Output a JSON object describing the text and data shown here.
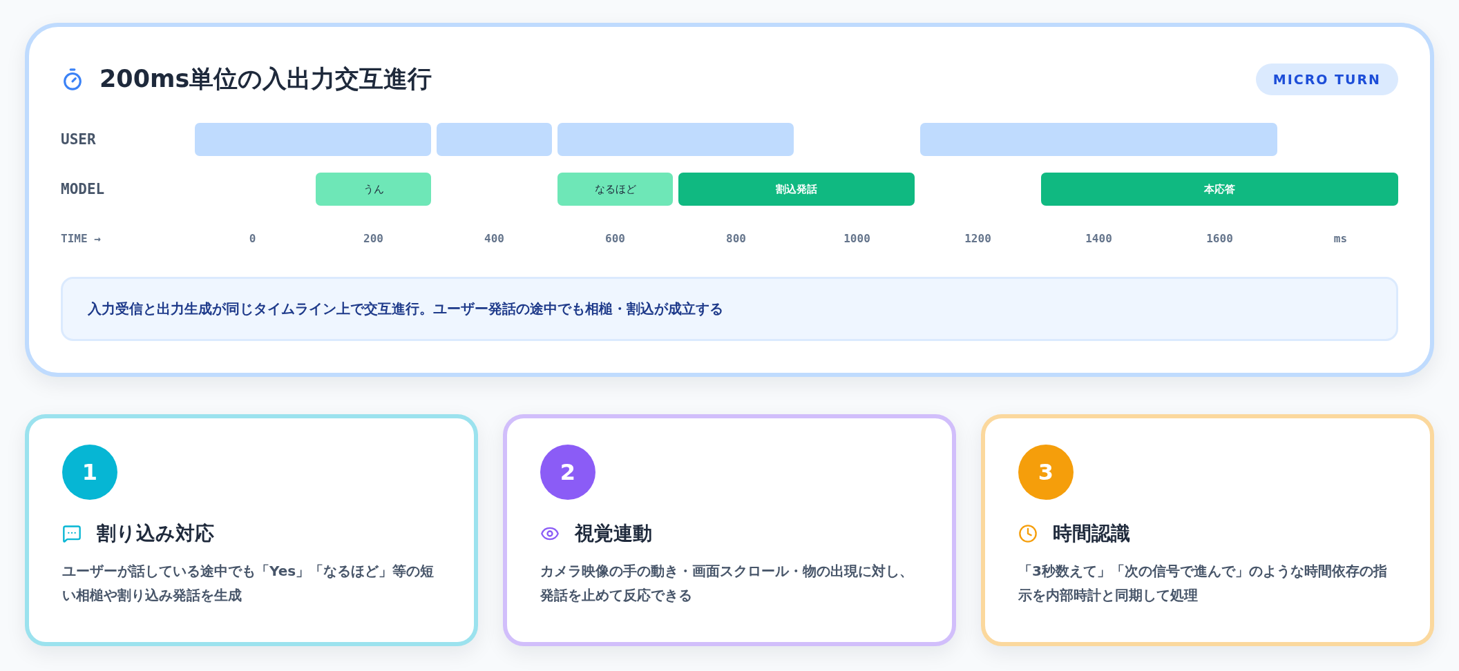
{
  "timeline_card": {
    "title": "200ms単位の入出力交互進行",
    "badge": "MICRO TURN",
    "tracks": [
      {
        "label": "USER",
        "segments": [
          {
            "kind": "input"
          },
          {
            "kind": "input"
          },
          {
            "kind": "input"
          },
          {
            "kind": "input"
          }
        ]
      },
      {
        "label": "MODEL",
        "segments": [
          {
            "kind": "backchannel",
            "text": "うん"
          },
          {
            "kind": "backchannel",
            "text": "なるほど"
          },
          {
            "kind": "response",
            "text": "割込発話"
          },
          {
            "kind": "response",
            "text": "本応答"
          }
        ]
      }
    ],
    "axis_label": "TIME →",
    "ticks": [
      "0",
      "200",
      "400",
      "600",
      "800",
      "1000",
      "1200",
      "1400",
      "1600",
      "ms"
    ],
    "note": "入力受信と出力生成が同じタイムライン上で交互進行。ユーザー発話の途中でも相槌・割込が成立する"
  },
  "features": [
    {
      "number": "1",
      "color": "#06b6d4",
      "title": "割り込み対応",
      "description": "ユーザーが話している途中でも「Yes」「なるほど」等の短い相槌や割り込み発話を生成"
    },
    {
      "number": "2",
      "color": "#8b5cf6",
      "title": "視覚連動",
      "description": "カメラ映像の手の動き・画面スクロール・物の出現に対し、発話を止めて反応できる"
    },
    {
      "number": "3",
      "color": "#f59e0b",
      "title": "時間認識",
      "description": "「3秒数えて」「次の信号で進んで」のような時間依存の指示を内部時計と同期して処理"
    }
  ]
}
